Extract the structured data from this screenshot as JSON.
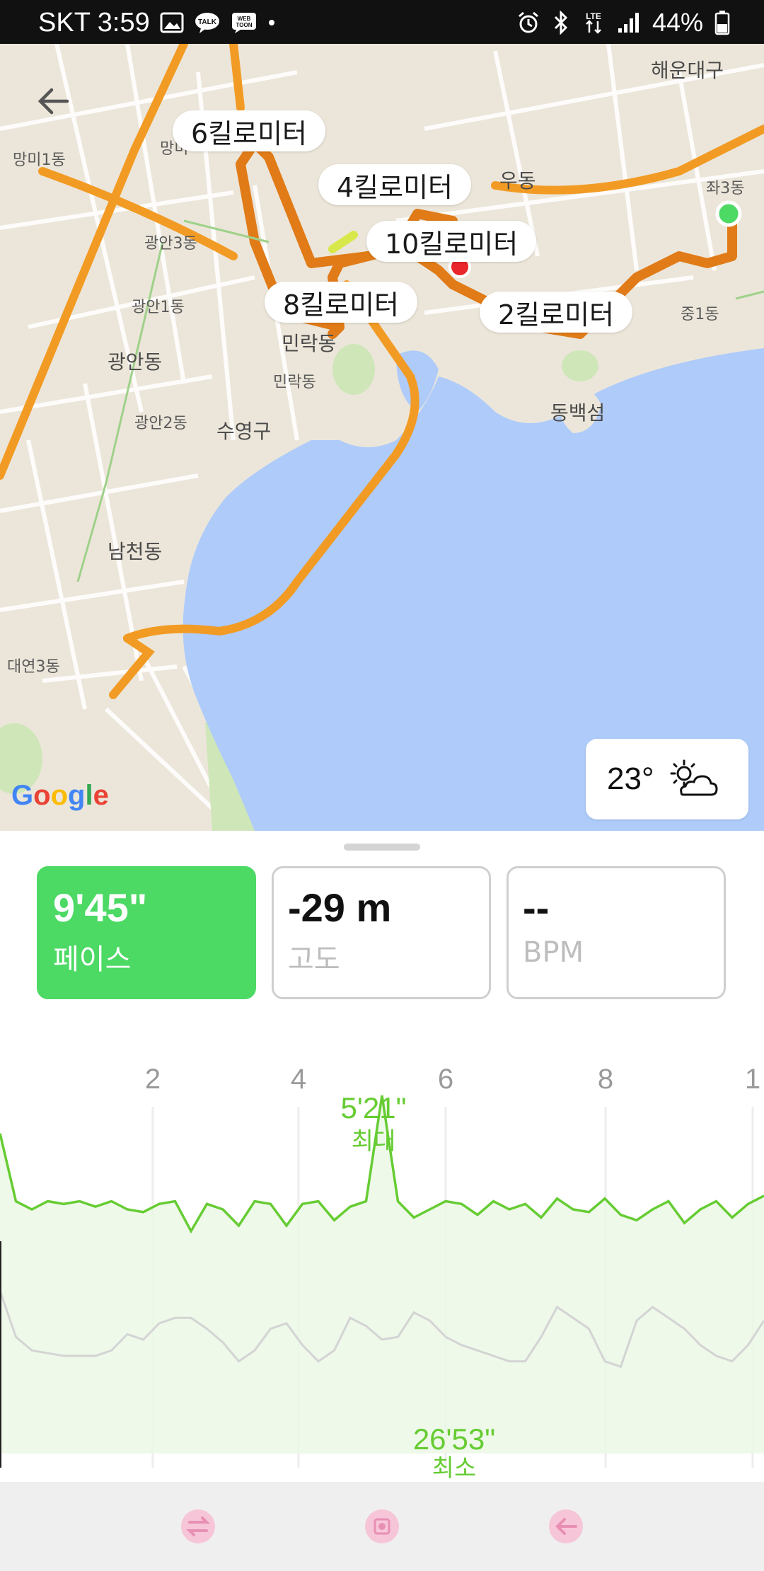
{
  "status_bar": {
    "carrier_time": "SKT 3:59",
    "battery": "44%",
    "icons": [
      "gallery-icon",
      "kakaotalk-icon",
      "webtoon-icon",
      "dot-icon",
      "alarm-icon",
      "bluetooth-icon",
      "lte-icon",
      "signal-icon",
      "battery-icon"
    ]
  },
  "map": {
    "km_labels": [
      "6킬로미터",
      "4킬로미터",
      "10킬로미터",
      "8킬로미터",
      "2킬로미터"
    ],
    "places": {
      "p1": "해운대구",
      "p2": "망미1동",
      "p3": "우동",
      "p4": "좌3동",
      "p5": "광안3동",
      "p6": "광안1동",
      "p7": "민락동",
      "p8": "민락동",
      "p9": "중1동",
      "p10": "광안동",
      "p11": "동백섬",
      "p12": "광안2동",
      "p13": "수영구",
      "p14": "남천동",
      "p15": "대연3동",
      "p16": "망미"
    },
    "google": "Google",
    "weather": {
      "temp": "23°",
      "icon": "partly-cloudy-sun-icon"
    },
    "colors": {
      "water": "#aecbfa",
      "land": "#ece6da",
      "route": "#f29b24",
      "route_dark": "#e07b18"
    }
  },
  "metrics": [
    {
      "value": "9'45\"",
      "label": "페이스",
      "active": true
    },
    {
      "value": "-29 m",
      "label": "고도",
      "active": false
    },
    {
      "value": "--",
      "label": "BPM",
      "active": false
    }
  ],
  "chart_data": {
    "type": "line",
    "x_ticks": [
      "2",
      "4",
      "6",
      "8",
      "1"
    ],
    "series": [
      {
        "values": [
          2,
          27,
          30,
          27,
          28,
          27,
          29,
          27,
          30,
          31,
          28,
          27,
          38,
          28,
          30,
          36,
          27,
          28,
          36,
          28,
          27,
          34,
          29,
          27,
          -12,
          27,
          33,
          30,
          27,
          28,
          32,
          27,
          30,
          28,
          33,
          26,
          30,
          31,
          26,
          32,
          34,
          30,
          27,
          35,
          30,
          27,
          33,
          28,
          25
        ]
      },
      {
        "values": [
          60,
          77,
          82,
          83,
          84,
          84,
          84,
          82,
          76,
          78,
          72,
          70,
          70,
          74,
          79,
          86,
          82,
          74,
          72,
          80,
          86,
          82,
          70,
          73,
          78,
          77,
          68,
          71,
          77,
          80,
          82,
          84,
          86,
          86,
          77,
          66,
          70,
          74,
          86,
          88,
          71,
          66,
          70,
          74,
          80,
          84,
          86,
          80,
          71
        ]
      }
    ],
    "annotations": [
      {
        "value": "5'21\"",
        "label": "최대"
      },
      {
        "value": "26'53\"",
        "label": "최소"
      }
    ],
    "colors": {
      "pace": "#66cc33",
      "elevation": "#d4d4d4",
      "fill": "#eaf7e4"
    }
  },
  "nav_bar": {
    "icons": [
      "swap-icon",
      "record-icon",
      "back-arrow-icon"
    ]
  }
}
